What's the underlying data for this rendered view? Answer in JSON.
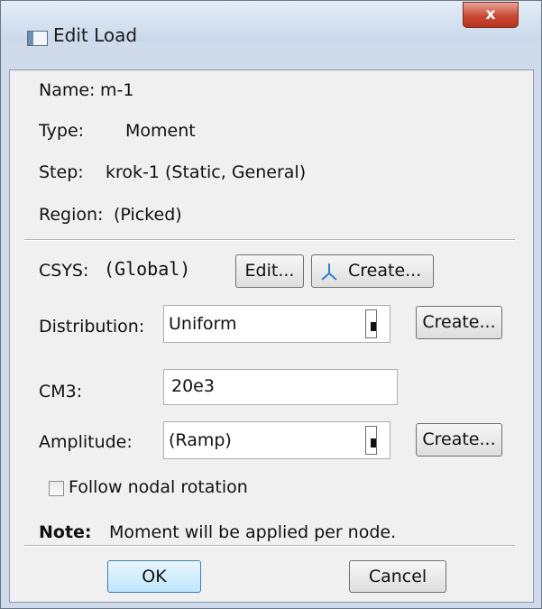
{
  "window": {
    "title": "Edit Load",
    "close_label": "x"
  },
  "info": {
    "name_label": "Name:",
    "name_value": "m-1",
    "type_label": "Type:",
    "type_value": "Moment",
    "step_label": "Step:",
    "step_value": "krok-1 (Static, General)",
    "region_label": "Region:",
    "region_value": "(Picked)"
  },
  "csys": {
    "label": "CSYS:",
    "value": "(Global)",
    "edit_label": "Edit...",
    "create_label": "Create..."
  },
  "distribution": {
    "label": "Distribution:",
    "value": "Uniform",
    "create_label": "Create..."
  },
  "cm3": {
    "label": "CM3:",
    "value": "20e3"
  },
  "amplitude": {
    "label": "Amplitude:",
    "value": "(Ramp)",
    "create_label": "Create..."
  },
  "follow_nodal_rotation": {
    "label": "Follow nodal rotation",
    "checked": false
  },
  "note": {
    "label": "Note:",
    "text": "Moment will be applied per node."
  },
  "buttons": {
    "ok_label": "OK",
    "cancel_label": "Cancel"
  },
  "colors": {
    "titlebar": "#d4e1f0",
    "close_button": "#c84a34",
    "dialog_background": "#f0f0f0",
    "default_button": "#bee6fd",
    "csys_icon": "#2f7fd0"
  }
}
